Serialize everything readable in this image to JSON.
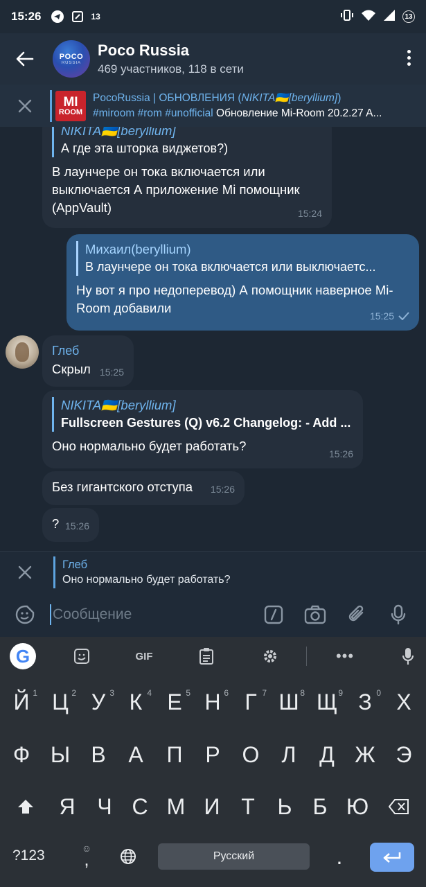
{
  "status": {
    "time": "15:26",
    "notif_count": "13",
    "battery_badge": "13"
  },
  "header": {
    "title": "Poco Russia",
    "subtitle": "469 участников, 118 в сети",
    "avatar_line1": "POCO",
    "avatar_line2": "RUSSIA"
  },
  "pinned": {
    "image_line1": "MI",
    "image_line2": "ROOM",
    "source": "PocoRussia | ОБНОВЛЕНИЯ",
    "source_author_prefix": " (",
    "source_author": "NIKITA🇺🇦[beryllium]",
    "source_author_suffix": ")",
    "tags": "#miroom #rom #unofficial",
    "body": " Обновление Mi-Room 20.2.27 A..."
  },
  "messages": [
    {
      "quote_name": "NIKITA🇺🇦[beryllium]",
      "quote_text": "А где эта шторка виджетов?)",
      "text": "В лаунчере он тока включается или выключается А приложение Mi помощник (AppVault)",
      "time": "15:24"
    },
    {
      "quote_name": "Михаил(beryllium)",
      "quote_text": "В лаунчере он тока включается или выключаетс...",
      "text": "Ну вот я про недоперевод) А помощник наверное Mi-Room добавили",
      "time": "15:25"
    },
    {
      "sender": "Глеб",
      "text": "Скрыл",
      "time": "15:25"
    },
    {
      "quote_name": "NIKITA🇺🇦[beryllium]",
      "quote_text": "Fullscreen Gestures (Q) v6.2 Changelog: - Add ...",
      "text": "Оно нормально будет работать?",
      "time": "15:26"
    },
    {
      "text": "Без гигантского отступа",
      "time": "15:26"
    },
    {
      "text": "?",
      "time": "15:26"
    }
  ],
  "reply": {
    "name": "Глеб",
    "text": "Оно нормально будет работать?"
  },
  "input": {
    "placeholder": "Сообщение"
  },
  "keyboard": {
    "gif": "GIF",
    "row1": [
      "Й",
      "Ц",
      "У",
      "К",
      "Е",
      "Н",
      "Г",
      "Ш",
      "Щ",
      "З",
      "Х"
    ],
    "row1_hints": [
      "1",
      "2",
      "3",
      "4",
      "5",
      "6",
      "7",
      "8",
      "9",
      "0",
      ""
    ],
    "row2": [
      "Ф",
      "Ы",
      "В",
      "А",
      "П",
      "Р",
      "О",
      "Л",
      "Д",
      "Ж",
      "Э"
    ],
    "row3": [
      "Я",
      "Ч",
      "С",
      "М",
      "И",
      "Т",
      "Ь",
      "Б",
      "Ю"
    ],
    "symbols": "?123",
    "comma": ",",
    "space": "Русский",
    "period": "."
  },
  "colors": {
    "background": "#1d2733",
    "header": "#232f3d",
    "incoming_bubble": "#252f3c",
    "outgoing_bubble": "#2f5a85",
    "accent": "#6fb4ee",
    "enter_key": "#6ea2ee"
  }
}
